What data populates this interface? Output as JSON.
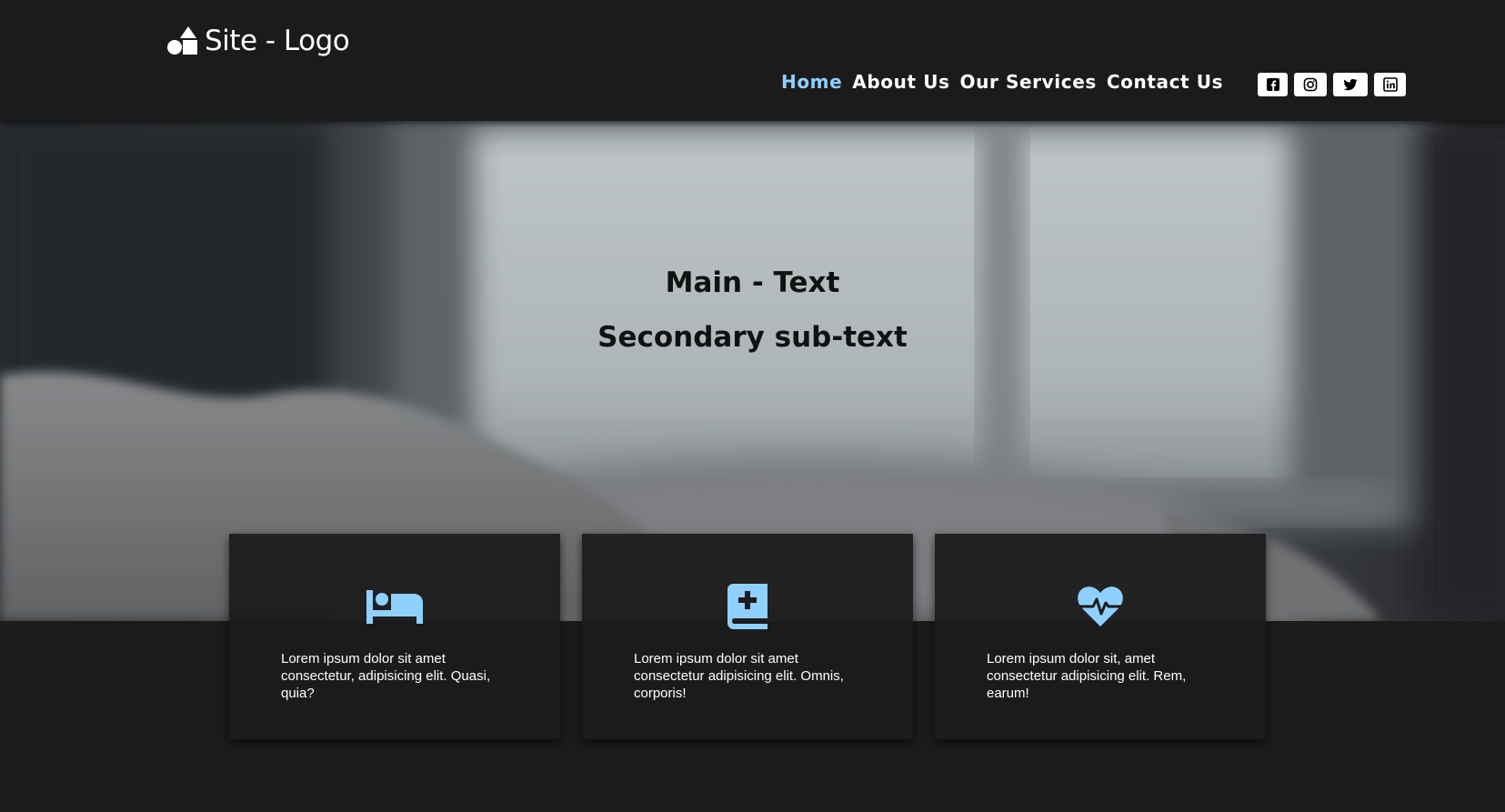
{
  "header": {
    "logo_text": "Site - Logo",
    "logo_icon": "shapes-icon",
    "nav": [
      {
        "label": "Home",
        "active": true
      },
      {
        "label": "About Us",
        "active": false
      },
      {
        "label": "Our Services",
        "active": false
      },
      {
        "label": "Contact Us",
        "active": false
      }
    ],
    "social": [
      "facebook-icon",
      "instagram-icon",
      "twitter-icon",
      "linkedin-icon"
    ]
  },
  "hero": {
    "title": "Main - Text",
    "subtitle": "Secondary sub-text"
  },
  "cards": [
    {
      "icon": "bed-icon",
      "text": "Lorem ipsum dolor sit amet consectetur, adipisicing elit. Quasi, quia?"
    },
    {
      "icon": "medical-book-icon",
      "text": "Lorem ipsum dolor sit amet consectetur adipisicing elit. Omnis, corporis!"
    },
    {
      "icon": "heartbeat-icon",
      "text": "Lorem ipsum dolor sit, amet consectetur adipisicing elit. Rem, earum!"
    }
  ],
  "colors": {
    "accent": "#8fd0ff",
    "background": "#1c1c1d",
    "icon": "#8fd0ff"
  }
}
